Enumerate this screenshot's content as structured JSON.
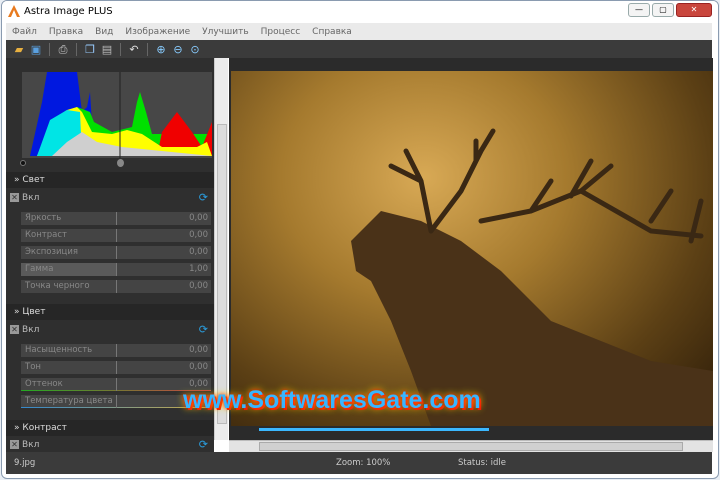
{
  "window": {
    "title": "Astra Image PLUS",
    "minimize": "—",
    "maximize": "▢",
    "close": "✕"
  },
  "menu": [
    "Файл",
    "Правка",
    "Вид",
    "Изображение",
    "Улучшить",
    "Процесс",
    "Справка"
  ],
  "toolbar": [
    "open",
    "save",
    "print",
    "copy",
    "paste",
    "undo",
    "zoom-in",
    "zoom-out",
    "zoom-fit"
  ],
  "panel": {
    "sections": [
      {
        "title": "Свет",
        "enabled_label": "Вкл",
        "sliders": [
          {
            "label": "Яркость",
            "value": "0,00"
          },
          {
            "label": "Контраст",
            "value": "0,00"
          },
          {
            "label": "Экспозиция",
            "value": "0,00"
          },
          {
            "label": "Гамма",
            "value": "1,00"
          },
          {
            "label": "Точка черного",
            "value": "0,00"
          }
        ]
      },
      {
        "title": "Цвет",
        "enabled_label": "Вкл",
        "sliders": [
          {
            "label": "Насыщенность",
            "value": "0,00"
          },
          {
            "label": "Тон",
            "value": "0,00"
          },
          {
            "label": "Оттенок",
            "value": "0,00"
          },
          {
            "label": "Температура цвета",
            "value": "0,00"
          }
        ]
      },
      {
        "title": "Контраст",
        "enabled_label": "Вкл"
      }
    ]
  },
  "watermark": "www.SoftwaresGate.com",
  "status": {
    "file": "9.jpg",
    "zoom": "Zoom: 100%",
    "state": "Status: idle"
  }
}
